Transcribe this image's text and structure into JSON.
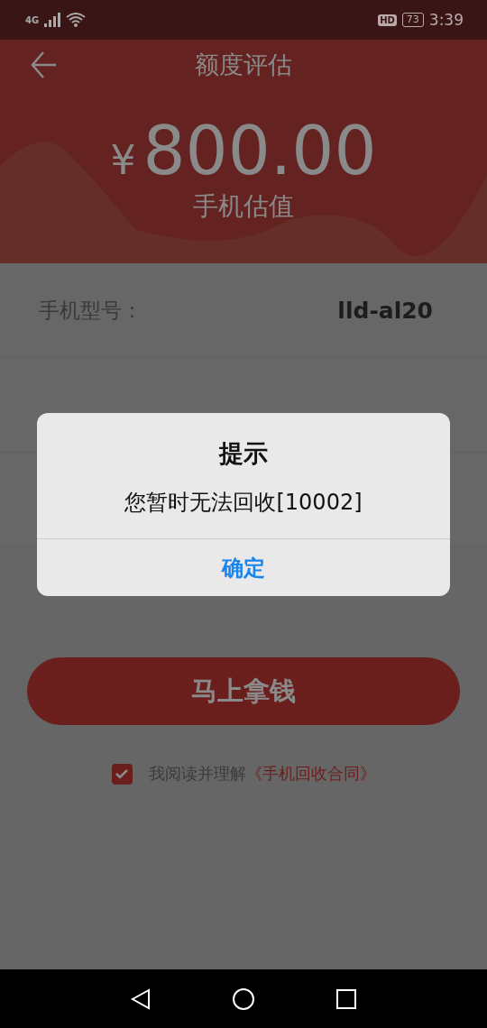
{
  "status_bar": {
    "network": "4G",
    "hd": "HD",
    "battery": "73",
    "time": "3:39"
  },
  "header": {
    "title": "额度评估",
    "currency": "¥",
    "amount": "800.00",
    "caption": "手机估值"
  },
  "details": [
    {
      "label": "手机型号：",
      "value": "lld-al20"
    }
  ],
  "primary_button": "马上拿钱",
  "agreement": {
    "checked": true,
    "text": "我阅读并理解",
    "link": "《手机回收合同》"
  },
  "dialog": {
    "title": "提示",
    "message": "您暂时无法回收[10002]",
    "confirm": "确定"
  }
}
